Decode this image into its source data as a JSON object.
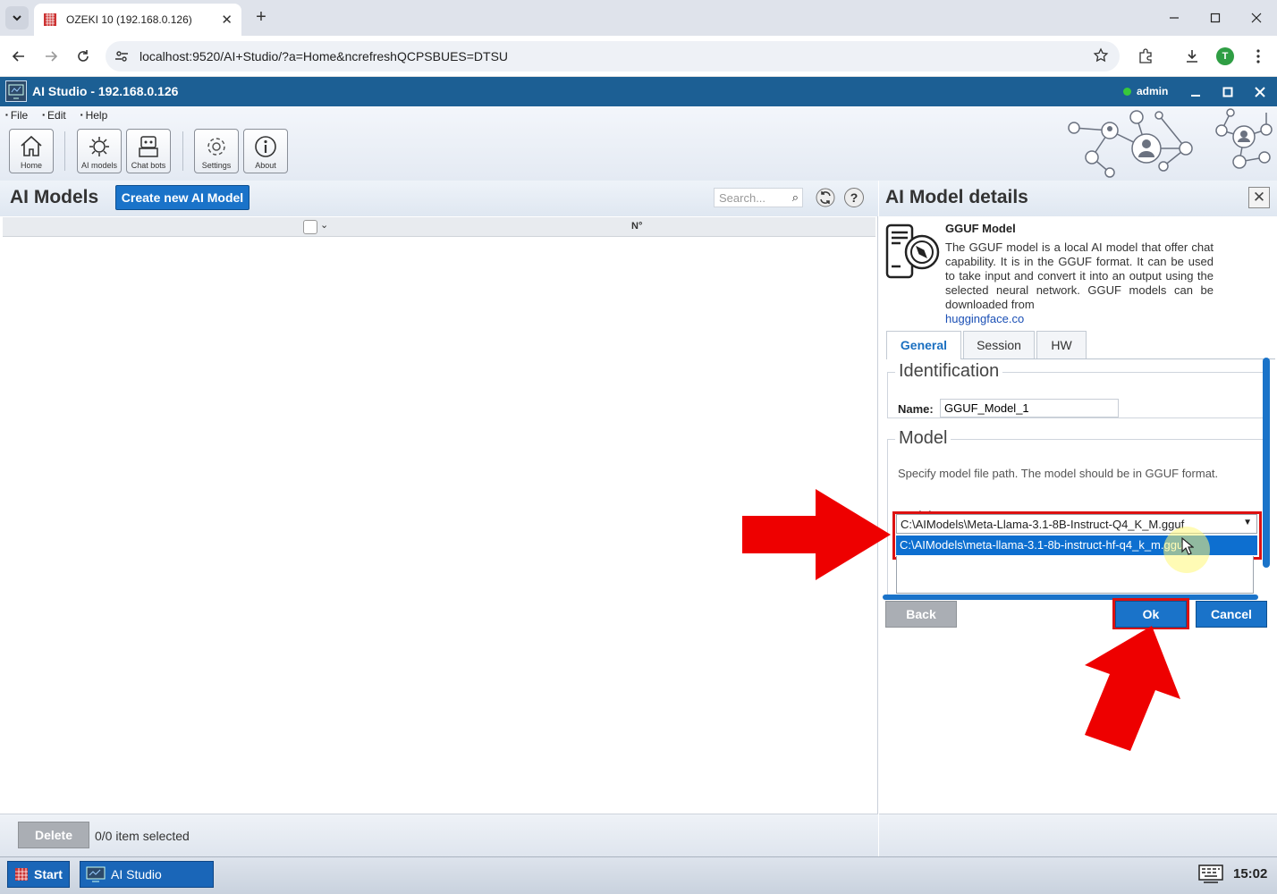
{
  "browser": {
    "tab_title": "OZEKI 10 (192.168.0.126)",
    "url": "localhost:9520/AI+Studio/?a=Home&ncrefreshQCPSBUES=DTSU",
    "profile_initial": "T"
  },
  "app": {
    "title": "AI Studio - 192.168.0.126",
    "user": "admin",
    "status_color": "#38c83a"
  },
  "menu": [
    "File",
    "Edit",
    "Help"
  ],
  "ribbon": {
    "home": "Home",
    "ai_models": "AI models",
    "chat_bots": "Chat bots",
    "settings": "Settings",
    "about": "About"
  },
  "left": {
    "title": "AI Models",
    "create_button": "Create new AI Model",
    "search_placeholder": "Search...",
    "column_no": "N°",
    "delete_button": "Delete",
    "selection_status": "0/0 item selected"
  },
  "right": {
    "title": "AI Model details",
    "model_type_title": "GGUF Model",
    "model_type_desc": "The GGUF model is a local AI model that offer chat capability. It is in the GGUF format. It can be used to take input and convert it into an output using the selected neural network. GGUF models can be downloaded from",
    "model_type_link": "huggingface.co",
    "tabs": [
      "General",
      "Session",
      "HW"
    ],
    "identification_legend": "Identification",
    "name_label": "Name:",
    "name_value": "GGUF_Model_1",
    "model_legend": "Model",
    "model_desc": "Specify model file path. The model should be in GGUF format.",
    "model_label": "Model:",
    "model_selected": "C:\\AIModels\\Meta-Llama-3.1-8B-Instruct-Q4_K_M.gguf",
    "model_option_highlighted": "C:\\AIModels\\meta-llama-3.1-8b-instruct-hf-q4_k_m.gguf",
    "back_button": "Back",
    "ok_button": "Ok",
    "cancel_button": "Cancel"
  },
  "taskbar": {
    "start": "Start",
    "task": "AI Studio",
    "clock": "15:02"
  },
  "colors": {
    "accent": "#1a73c9",
    "titlebar": "#1c5f94",
    "annotation": "#ee0000"
  }
}
